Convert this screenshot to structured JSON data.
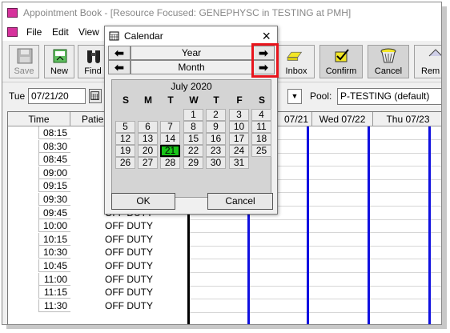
{
  "window": {
    "title": "Appointment Book - [Resource Focused:  GENEPHYSC in TESTING at PMH]"
  },
  "menu": [
    "File",
    "Edit",
    "View"
  ],
  "toolbar": {
    "save": "Save",
    "new": "New",
    "find": "Find",
    "inbox": "Inbox",
    "confirm": "Confirm",
    "cancel": "Cancel",
    "rem": "Rem"
  },
  "date_row": {
    "day_label": "Tue",
    "date_value": "07/21/20",
    "pool_label": "Pool:",
    "pool_value": "P-TESTING (default)"
  },
  "grid": {
    "headers": [
      "Time",
      "Patier",
      "07/21",
      "Wed 07/22",
      "Thu 07/23"
    ],
    "times": [
      "08:15",
      "08:30",
      "08:45",
      "09:00",
      "09:15",
      "09:30",
      "09:45",
      "10:00",
      "10:15",
      "10:30",
      "10:45",
      "11:00",
      "11:15",
      "11:30"
    ],
    "status_text": "OFF DUTY"
  },
  "calendar": {
    "title": "Calendar",
    "close": "×",
    "year_label": "Year",
    "month_label": "Month",
    "prev_arrow": "⬅",
    "next_arrow": "➡",
    "month_title": "July 2020",
    "weekdays": [
      "S",
      "M",
      "T",
      "W",
      "T",
      "F",
      "S"
    ],
    "weeks": [
      [
        "",
        "",
        "",
        "1",
        "2",
        "3",
        "4"
      ],
      [
        "5",
        "6",
        "7",
        "8",
        "9",
        "10",
        "11"
      ],
      [
        "12",
        "13",
        "14",
        "15",
        "16",
        "17",
        "18"
      ],
      [
        "19",
        "20",
        "21",
        "22",
        "23",
        "24",
        "25"
      ],
      [
        "26",
        "27",
        "28",
        "29",
        "30",
        "31",
        ""
      ]
    ],
    "selected_day": "21",
    "ok": "OK",
    "cancel": "Cancel"
  },
  "colors": {
    "highlight_box": "#e8141c",
    "selected_day": "#18c418",
    "column_divider": "#1010e0",
    "app_icon": "#d6329c"
  }
}
